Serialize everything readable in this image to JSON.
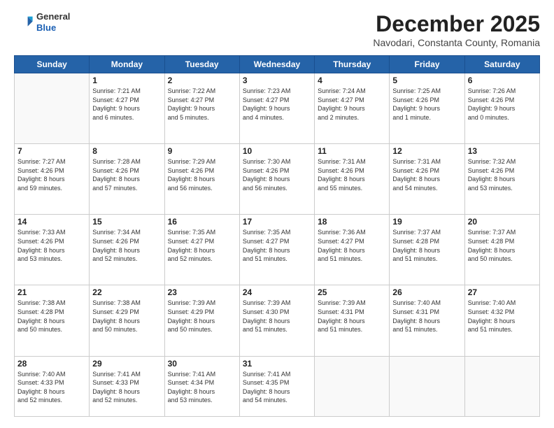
{
  "header": {
    "logo": {
      "general": "General",
      "blue": "Blue"
    },
    "month": "December 2025",
    "location": "Navodari, Constanta County, Romania"
  },
  "weekdays": [
    "Sunday",
    "Monday",
    "Tuesday",
    "Wednesday",
    "Thursday",
    "Friday",
    "Saturday"
  ],
  "weeks": [
    [
      {
        "day": "",
        "info": ""
      },
      {
        "day": "1",
        "info": "Sunrise: 7:21 AM\nSunset: 4:27 PM\nDaylight: 9 hours\nand 6 minutes."
      },
      {
        "day": "2",
        "info": "Sunrise: 7:22 AM\nSunset: 4:27 PM\nDaylight: 9 hours\nand 5 minutes."
      },
      {
        "day": "3",
        "info": "Sunrise: 7:23 AM\nSunset: 4:27 PM\nDaylight: 9 hours\nand 4 minutes."
      },
      {
        "day": "4",
        "info": "Sunrise: 7:24 AM\nSunset: 4:27 PM\nDaylight: 9 hours\nand 2 minutes."
      },
      {
        "day": "5",
        "info": "Sunrise: 7:25 AM\nSunset: 4:26 PM\nDaylight: 9 hours\nand 1 minute."
      },
      {
        "day": "6",
        "info": "Sunrise: 7:26 AM\nSunset: 4:26 PM\nDaylight: 9 hours\nand 0 minutes."
      }
    ],
    [
      {
        "day": "7",
        "info": "Sunrise: 7:27 AM\nSunset: 4:26 PM\nDaylight: 8 hours\nand 59 minutes."
      },
      {
        "day": "8",
        "info": "Sunrise: 7:28 AM\nSunset: 4:26 PM\nDaylight: 8 hours\nand 57 minutes."
      },
      {
        "day": "9",
        "info": "Sunrise: 7:29 AM\nSunset: 4:26 PM\nDaylight: 8 hours\nand 56 minutes."
      },
      {
        "day": "10",
        "info": "Sunrise: 7:30 AM\nSunset: 4:26 PM\nDaylight: 8 hours\nand 56 minutes."
      },
      {
        "day": "11",
        "info": "Sunrise: 7:31 AM\nSunset: 4:26 PM\nDaylight: 8 hours\nand 55 minutes."
      },
      {
        "day": "12",
        "info": "Sunrise: 7:31 AM\nSunset: 4:26 PM\nDaylight: 8 hours\nand 54 minutes."
      },
      {
        "day": "13",
        "info": "Sunrise: 7:32 AM\nSunset: 4:26 PM\nDaylight: 8 hours\nand 53 minutes."
      }
    ],
    [
      {
        "day": "14",
        "info": "Sunrise: 7:33 AM\nSunset: 4:26 PM\nDaylight: 8 hours\nand 53 minutes."
      },
      {
        "day": "15",
        "info": "Sunrise: 7:34 AM\nSunset: 4:26 PM\nDaylight: 8 hours\nand 52 minutes."
      },
      {
        "day": "16",
        "info": "Sunrise: 7:35 AM\nSunset: 4:27 PM\nDaylight: 8 hours\nand 52 minutes."
      },
      {
        "day": "17",
        "info": "Sunrise: 7:35 AM\nSunset: 4:27 PM\nDaylight: 8 hours\nand 51 minutes."
      },
      {
        "day": "18",
        "info": "Sunrise: 7:36 AM\nSunset: 4:27 PM\nDaylight: 8 hours\nand 51 minutes."
      },
      {
        "day": "19",
        "info": "Sunrise: 7:37 AM\nSunset: 4:28 PM\nDaylight: 8 hours\nand 51 minutes."
      },
      {
        "day": "20",
        "info": "Sunrise: 7:37 AM\nSunset: 4:28 PM\nDaylight: 8 hours\nand 50 minutes."
      }
    ],
    [
      {
        "day": "21",
        "info": "Sunrise: 7:38 AM\nSunset: 4:28 PM\nDaylight: 8 hours\nand 50 minutes."
      },
      {
        "day": "22",
        "info": "Sunrise: 7:38 AM\nSunset: 4:29 PM\nDaylight: 8 hours\nand 50 minutes."
      },
      {
        "day": "23",
        "info": "Sunrise: 7:39 AM\nSunset: 4:29 PM\nDaylight: 8 hours\nand 50 minutes."
      },
      {
        "day": "24",
        "info": "Sunrise: 7:39 AM\nSunset: 4:30 PM\nDaylight: 8 hours\nand 51 minutes."
      },
      {
        "day": "25",
        "info": "Sunrise: 7:39 AM\nSunset: 4:31 PM\nDaylight: 8 hours\nand 51 minutes."
      },
      {
        "day": "26",
        "info": "Sunrise: 7:40 AM\nSunset: 4:31 PM\nDaylight: 8 hours\nand 51 minutes."
      },
      {
        "day": "27",
        "info": "Sunrise: 7:40 AM\nSunset: 4:32 PM\nDaylight: 8 hours\nand 51 minutes."
      }
    ],
    [
      {
        "day": "28",
        "info": "Sunrise: 7:40 AM\nSunset: 4:33 PM\nDaylight: 8 hours\nand 52 minutes."
      },
      {
        "day": "29",
        "info": "Sunrise: 7:41 AM\nSunset: 4:33 PM\nDaylight: 8 hours\nand 52 minutes."
      },
      {
        "day": "30",
        "info": "Sunrise: 7:41 AM\nSunset: 4:34 PM\nDaylight: 8 hours\nand 53 minutes."
      },
      {
        "day": "31",
        "info": "Sunrise: 7:41 AM\nSunset: 4:35 PM\nDaylight: 8 hours\nand 54 minutes."
      },
      {
        "day": "",
        "info": ""
      },
      {
        "day": "",
        "info": ""
      },
      {
        "day": "",
        "info": ""
      }
    ]
  ]
}
